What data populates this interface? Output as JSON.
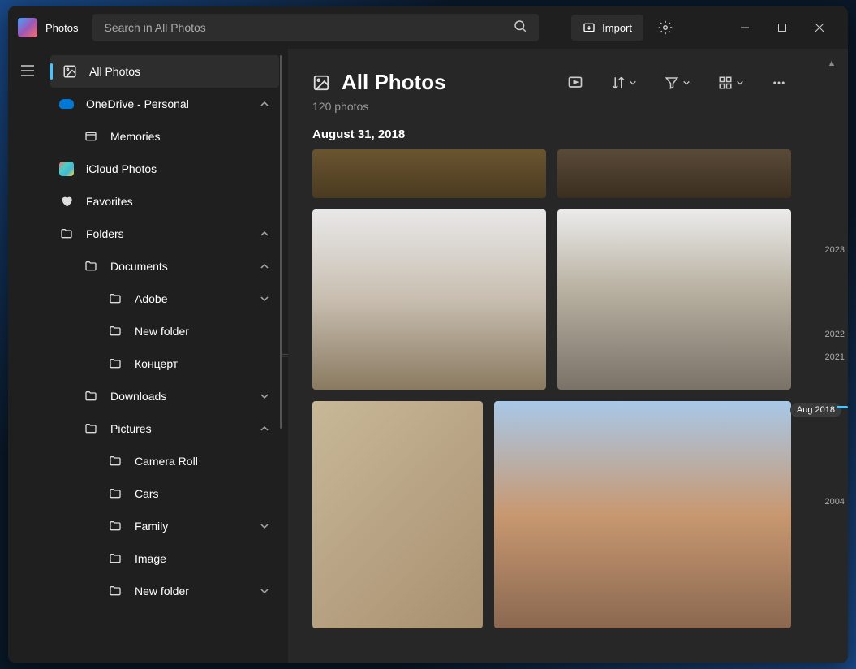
{
  "app_title": "Photos",
  "search": {
    "placeholder": "Search in All Photos"
  },
  "import_label": "Import",
  "sidebar": {
    "all_photos": "All Photos",
    "onedrive": "OneDrive - Personal",
    "memories": "Memories",
    "icloud": "iCloud Photos",
    "favorites": "Favorites",
    "folders": "Folders",
    "documents": "Documents",
    "adobe": "Adobe",
    "new_folder": "New folder",
    "koncert": "Концерт",
    "downloads": "Downloads",
    "pictures": "Pictures",
    "camera_roll": "Camera Roll",
    "cars": "Cars",
    "family": "Family",
    "image": "Image",
    "new_folder2": "New folder"
  },
  "main": {
    "title": "All Photos",
    "subtitle": "120 photos",
    "date_group": "August 31, 2018"
  },
  "timeline": {
    "y2023": "2023",
    "y2022": "2022",
    "y2021": "2021",
    "current": "Aug 2018",
    "y2004": "2004"
  }
}
